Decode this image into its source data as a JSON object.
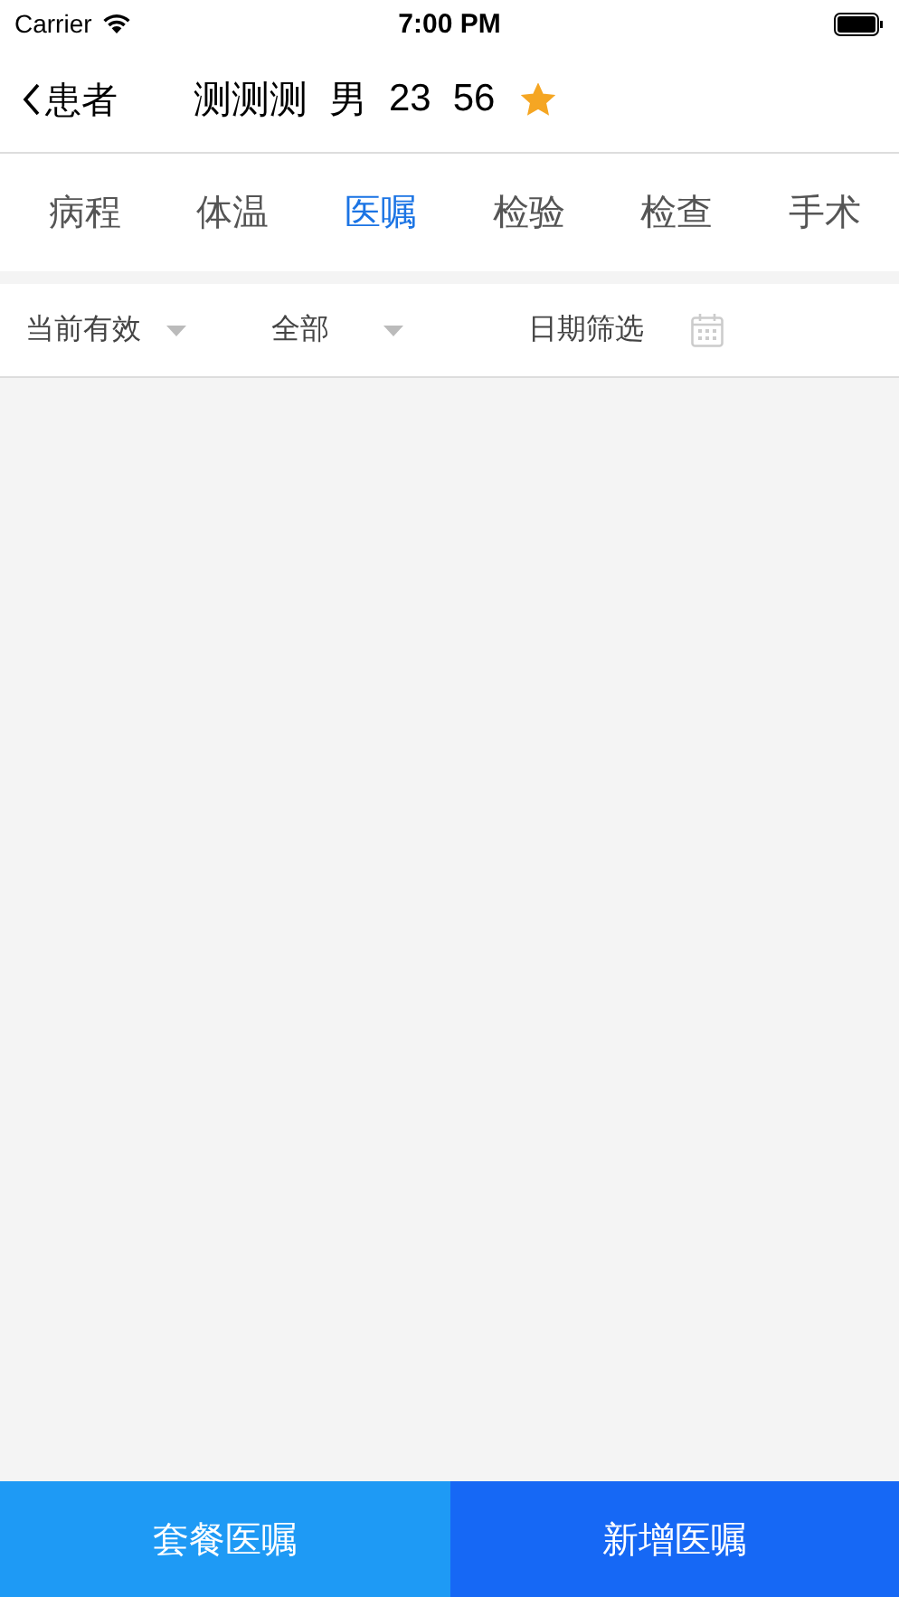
{
  "status_bar": {
    "carrier": "Carrier",
    "time": "7:00 PM"
  },
  "nav": {
    "back": "患者",
    "patient": {
      "name": "测测测",
      "sex": "男",
      "field_1": "23",
      "field_2": "56",
      "starred": true
    }
  },
  "tabs": [
    {
      "label": "病程",
      "selected": false
    },
    {
      "label": "体温",
      "selected": false
    },
    {
      "label": "医嘱",
      "selected": true
    },
    {
      "label": "检验",
      "selected": false
    },
    {
      "label": "检查",
      "selected": false
    },
    {
      "label": "手术",
      "selected": false
    }
  ],
  "filters": [
    {
      "kind": "dropdown",
      "label": "当前有效"
    },
    {
      "kind": "dropdown",
      "label": "全部"
    },
    {
      "kind": "date",
      "label": "日期筛选"
    }
  ],
  "buttons": [
    {
      "kind": "secondary",
      "label": "套餐医嘱"
    },
    {
      "kind": "primary",
      "label": "新增医嘱"
    }
  ]
}
